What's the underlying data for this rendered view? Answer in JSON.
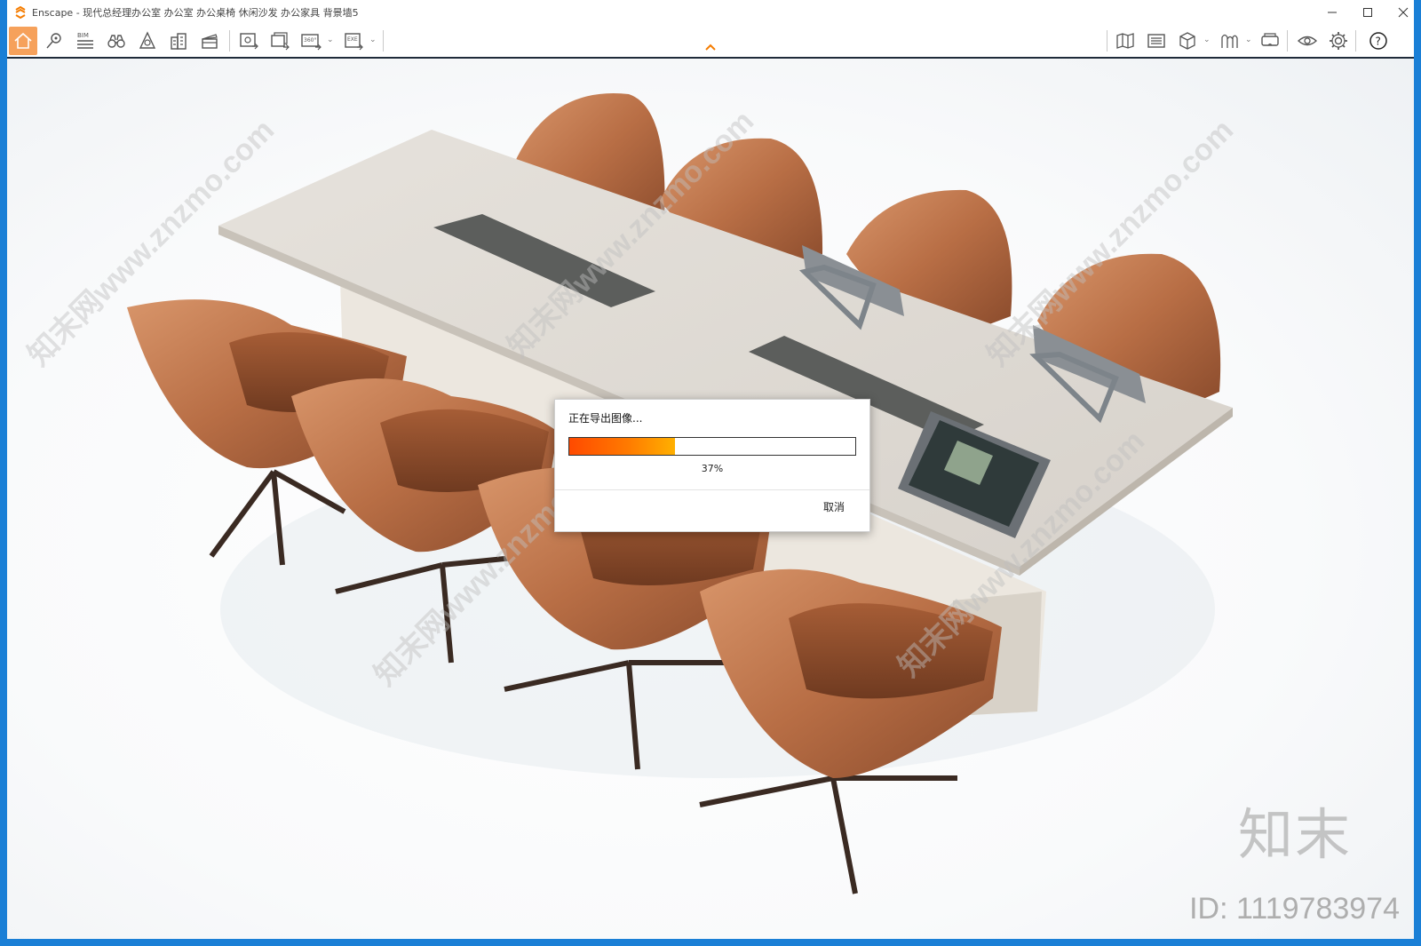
{
  "window": {
    "title": "Enscape - 现代总经理办公室 办公室 办公桌椅 休闲沙发 办公家具 背景墙5",
    "minimize_icon": "minimize-icon",
    "maximize_icon": "maximize-icon",
    "close_icon": "close-icon"
  },
  "toolbar": {
    "bim_label": "BIM",
    "panorama_label": "360°",
    "exe_label": "EXE",
    "help_label": "?",
    "left_icons": [
      "home-icon",
      "location-icon",
      "bim-icon",
      "binoculars-icon",
      "sun-icon",
      "buildings-icon",
      "clapboard-icon",
      "screenshot-export-icon",
      "batch-export-icon",
      "panorama-icon",
      "exe-export-icon"
    ],
    "right_icons": [
      "map-icon",
      "material-editor-icon",
      "cube-icon",
      "asset-library-icon",
      "vr-headset-icon",
      "eye-icon",
      "settings-icon",
      "help-icon"
    ]
  },
  "dialog": {
    "title": "正在导出图像...",
    "progress": 0.37,
    "progress_text": "37%",
    "cancel_label": "取消"
  },
  "watermark": {
    "logo": "知末",
    "id_text": "ID: 1119783974",
    "repeat_text": "知末网www.znzmo.com"
  },
  "colors": {
    "accent_home": "#f6a15b",
    "desktop_blue": "#1a7fd6",
    "progress_start": "#ff4a00",
    "progress_end": "#ffb000"
  }
}
